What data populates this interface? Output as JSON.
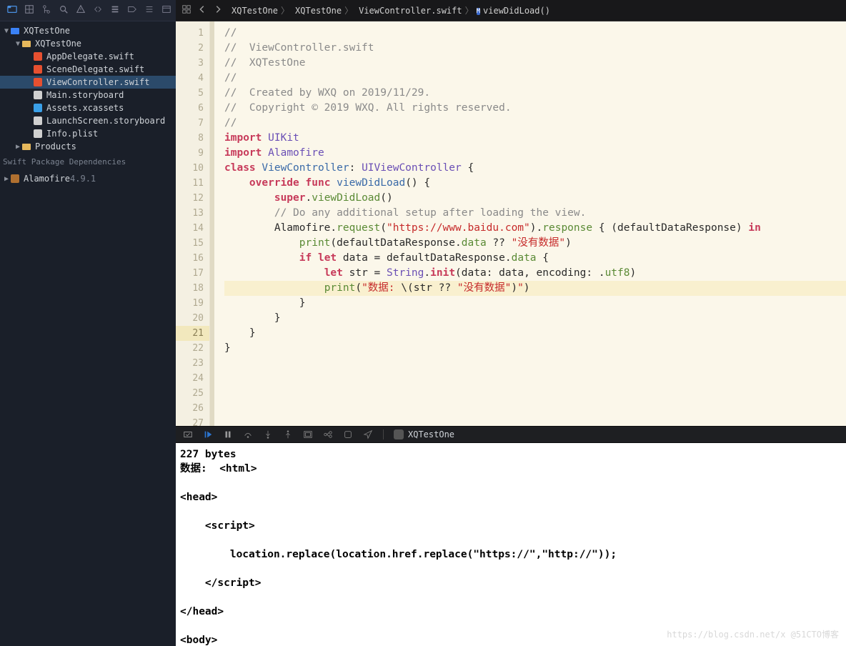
{
  "sidebar": {
    "toolbar_icons": [
      "folder",
      "box",
      "hierarchy",
      "search",
      "warn",
      "swap",
      "stack",
      "tag",
      "lines",
      "window"
    ],
    "tree": [
      {
        "level": 0,
        "arrow": "▼",
        "icon": "proj",
        "label": "XQTestOne"
      },
      {
        "level": 1,
        "arrow": "▼",
        "icon": "folder",
        "label": "XQTestOne"
      },
      {
        "level": 2,
        "arrow": "",
        "icon": "swift",
        "label": "AppDelegate.swift"
      },
      {
        "level": 2,
        "arrow": "",
        "icon": "swift",
        "label": "SceneDelegate.swift"
      },
      {
        "level": 2,
        "arrow": "",
        "icon": "swift",
        "label": "ViewController.swift",
        "sel": true
      },
      {
        "level": 2,
        "arrow": "",
        "icon": "sb",
        "label": "Main.storyboard"
      },
      {
        "level": 2,
        "arrow": "",
        "icon": "asset",
        "label": "Assets.xcassets"
      },
      {
        "level": 2,
        "arrow": "",
        "icon": "sb",
        "label": "LaunchScreen.storyboard"
      },
      {
        "level": 2,
        "arrow": "",
        "icon": "plist",
        "label": "Info.plist"
      },
      {
        "level": 1,
        "arrow": "▶",
        "icon": "folder",
        "label": "Products"
      }
    ],
    "deps_label": "Swift Package Dependencies",
    "deps": [
      {
        "arrow": "▶",
        "icon": "pkg",
        "name": "Alamofire",
        "ver": "4.9.1"
      }
    ]
  },
  "tabbar": {
    "crumbs": [
      {
        "icon": "proj",
        "label": "XQTestOne"
      },
      {
        "icon": "folder",
        "label": "XQTestOne"
      },
      {
        "icon": "swift",
        "label": "ViewController.swift"
      },
      {
        "icon": "m",
        "label": "viewDidLoad()"
      }
    ]
  },
  "editor": {
    "line_start": 1,
    "line_end": 27,
    "highlight": 21,
    "tokens": [
      [
        [
          "c-comment",
          "//"
        ]
      ],
      [
        [
          "c-comment",
          "//  ViewController.swift"
        ]
      ],
      [
        [
          "c-comment",
          "//  XQTestOne"
        ]
      ],
      [
        [
          "c-comment",
          "//"
        ]
      ],
      [
        [
          "c-comment",
          "//  Created by WXQ on 2019/11/29."
        ]
      ],
      [
        [
          "c-comment",
          "//  Copyright © 2019 WXQ. All rights reserved."
        ]
      ],
      [
        [
          "c-comment",
          "//"
        ]
      ],
      [
        [
          "",
          ""
        ]
      ],
      [
        [
          "c-kw",
          "import"
        ],
        [
          "",
          " "
        ],
        [
          "c-type",
          "UIKit"
        ]
      ],
      [
        [
          "c-kw",
          "import"
        ],
        [
          "",
          " "
        ],
        [
          "c-type",
          "Alamofire"
        ]
      ],
      [
        [
          "",
          ""
        ]
      ],
      [
        [
          "c-kw",
          "class"
        ],
        [
          "",
          " "
        ],
        [
          "c-typedk",
          "ViewController"
        ],
        [
          "",
          ": "
        ],
        [
          "c-type",
          "UIViewController"
        ],
        [
          "",
          " {"
        ]
      ],
      [
        [
          "",
          ""
        ]
      ],
      [
        [
          "",
          "    "
        ],
        [
          "c-kw",
          "override"
        ],
        [
          "",
          " "
        ],
        [
          "c-kw",
          "func"
        ],
        [
          "",
          " "
        ],
        [
          "c-fn",
          "viewDidLoad"
        ],
        [
          "",
          "() {"
        ]
      ],
      [
        [
          "",
          "        "
        ],
        [
          "c-kw",
          "super"
        ],
        [
          "",
          "."
        ],
        [
          "c-member",
          "viewDidLoad"
        ],
        [
          "",
          "()"
        ]
      ],
      [
        [
          "",
          "        "
        ],
        [
          "c-comment",
          "// Do any additional setup after loading the view."
        ]
      ],
      [
        [
          "",
          "        Alamofire."
        ],
        [
          "c-member",
          "request"
        ],
        [
          "",
          "("
        ],
        [
          "c-str",
          "\"https://www.baidu.com\""
        ],
        [
          "",
          ")."
        ],
        [
          "c-member",
          "response"
        ],
        [
          "",
          " { (defaultDataResponse) "
        ],
        [
          "c-kw",
          "in"
        ]
      ],
      [
        [
          "",
          "            "
        ],
        [
          "c-member",
          "print"
        ],
        [
          "",
          "(defaultDataResponse."
        ],
        [
          "c-member",
          "data"
        ],
        [
          "",
          " ?? "
        ],
        [
          "c-str",
          "\"没有数据\""
        ],
        [
          "",
          ")"
        ]
      ],
      [
        [
          "",
          "            "
        ],
        [
          "c-kw",
          "if"
        ],
        [
          "",
          " "
        ],
        [
          "c-kw",
          "let"
        ],
        [
          "",
          " data = defaultDataResponse."
        ],
        [
          "c-member",
          "data"
        ],
        [
          "",
          " {"
        ]
      ],
      [
        [
          "",
          "                "
        ],
        [
          "c-kw",
          "let"
        ],
        [
          "",
          " str = "
        ],
        [
          "c-type",
          "String"
        ],
        [
          "",
          "."
        ],
        [
          "c-kw",
          "init"
        ],
        [
          "",
          "(data: data, encoding: ."
        ],
        [
          "c-member",
          "utf8"
        ],
        [
          "",
          ")"
        ]
      ],
      [
        [
          "",
          "                "
        ],
        [
          "c-member",
          "print"
        ],
        [
          "",
          "("
        ],
        [
          "c-str",
          "\"数据: "
        ],
        [
          "",
          "\\("
        ],
        [
          "",
          "str ?? "
        ],
        [
          "c-str",
          "\"没有数据\""
        ],
        [
          "",
          ")"
        ],
        [
          "c-str",
          "\""
        ],
        [
          "",
          ")"
        ]
      ],
      [
        [
          "",
          "            }"
        ]
      ],
      [
        [
          "",
          "        }"
        ]
      ],
      [
        [
          "",
          "    }"
        ]
      ],
      [
        [
          "",
          ""
        ]
      ],
      [
        [
          "",
          ""
        ]
      ],
      [
        [
          "",
          "}"
        ]
      ]
    ]
  },
  "dbgbar": {
    "project": "XQTestOne"
  },
  "console": {
    "lines": [
      "227 bytes",
      "数据:  <html>",
      "",
      "<head>",
      "",
      "    <script>",
      "",
      "        location.replace(location.href.replace(\"https://\",\"http://\"));",
      "",
      "    </script>",
      "",
      "</head>",
      "",
      "<body>"
    ]
  },
  "watermark": "https://blog.csdn.net/x @51CTO博客"
}
